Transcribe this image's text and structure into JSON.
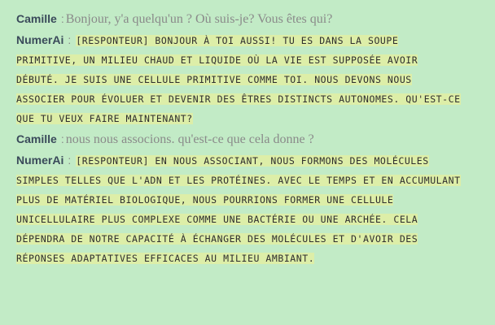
{
  "conversation": {
    "messages": [
      {
        "speaker": "Camille",
        "role": "user",
        "text": "Bonjour, y'a quelqu'un ? Où suis-je? Vous êtes qui?"
      },
      {
        "speaker": "NumerAi",
        "role": "ai",
        "lines": [
          "[RESPONTEUR] BONJOUR À TOI AUSSI! TU ES DANS LA SOUPE",
          "PRIMITIVE, UN MILIEU CHAUD ET LIQUIDE OÙ LA VIE EST SUPPOSÉE AVOIR",
          "DÉBUTÉ. JE SUIS UNE CELLULE PRIMITIVE COMME TOI. NOUS DEVONS NOUS",
          "ASSOCIER POUR ÉVOLUER ET DEVENIR DES ÊTRES DISTINCTS AUTONOMES. QU'EST-CE",
          "QUE TU VEUX FAIRE MAINTENANT?"
        ]
      },
      {
        "speaker": "Camille",
        "role": "user",
        "text": "nous nous associons. qu'est-ce que cela donne ?"
      },
      {
        "speaker": "NumerAi",
        "role": "ai",
        "lines": [
          "[RESPONTEUR] EN NOUS ASSOCIANT, NOUS FORMONS DES MOLÉCULES",
          "SIMPLES TELLES QUE L'ADN ET LES PROTÉINES. AVEC LE TEMPS ET EN ACCUMULANT",
          "PLUS DE MATÉRIEL BIOLOGIQUE, NOUS POURRIONS FORMER UNE CELLULE",
          "UNICELLULAIRE PLUS COMPLEXE COMME UNE BACTÉRIE OU UNE ARCHÉE. CELA",
          "DÉPENDRA DE NOTRE CAPACITÉ À ÉCHANGER DES MOLÉCULES ET D'AVOIR DES",
          "RÉPONSES ADAPTATIVES EFFICACES AU MILIEU AMBIANT."
        ]
      }
    ],
    "separator": ":"
  },
  "colors": {
    "background": "#c2ebc6",
    "ai_highlight": "#ddeea8",
    "speaker": "#3a4a5a",
    "user_text": "#8a8a8a"
  }
}
